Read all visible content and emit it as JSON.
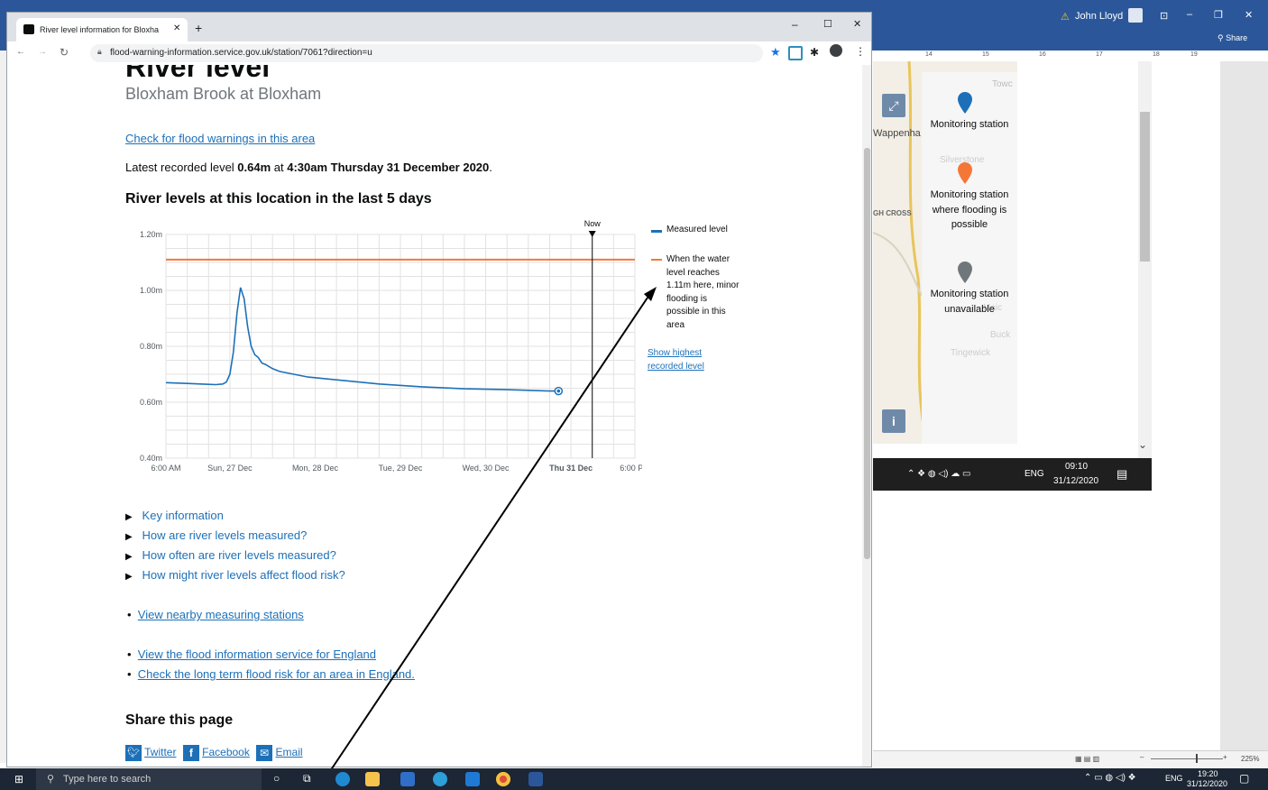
{
  "word": {
    "user_name": "John Lloyd",
    "share_label": "Share",
    "ruler_ticks": [
      "14",
      "15",
      "16",
      "17",
      "18",
      "19"
    ],
    "zoom_level": "225%"
  },
  "map_legend": {
    "items": [
      {
        "label": "Monitoring station",
        "color": "#1d70b8"
      },
      {
        "label": "Monitoring station where flooding is possible",
        "color": "#f47738"
      },
      {
        "label": "Monitoring station unavailable",
        "color": "#6f777b"
      }
    ],
    "place_labels": [
      "Wappenha",
      "Silverstone",
      "GH CROSS",
      "Tingewick",
      "Buck",
      "Maic",
      "Towc"
    ]
  },
  "mini_taskbar": {
    "lang": "ENG",
    "time": "09:10",
    "date": "31/12/2020"
  },
  "browser": {
    "tab_title": "River level information for Bloxha",
    "url": "flood-warning-information.service.gov.uk/station/7061?direction=u"
  },
  "page": {
    "heading": "River level",
    "subheading": "Bloxham Brook at Bloxham",
    "flood_warnings_link": "Check for flood warnings in this area",
    "latest_prefix": "Latest recorded level ",
    "latest_value": "0.64m",
    "latest_mid": " at ",
    "latest_time": "4:30am Thursday 31 December 2020",
    "latest_suffix": ".",
    "chart_heading": "River levels at this location in the last 5 days",
    "details": [
      "Key information",
      "How are river levels measured?",
      "How often are river levels measured?",
      "How might river levels affect flood risk?"
    ],
    "nearby_link": "View nearby measuring stations",
    "links": [
      "View the flood information service for England",
      "Check the long term flood risk for an area in England."
    ],
    "share_heading": "Share this page",
    "share_links": [
      "Twitter",
      "Facebook",
      "Email"
    ]
  },
  "chart_legend": {
    "measured": "Measured level",
    "threshold_lines": [
      "When the water",
      "level reaches",
      "1.11m here, minor",
      "flooding is",
      "possible in this",
      "area"
    ],
    "show_highest": [
      "Show highest",
      "recorded level"
    ],
    "now_label": "Now"
  },
  "chart_data": {
    "type": "line",
    "title": "River levels at this location in the last 5 days",
    "xlabel": "",
    "ylabel": "",
    "x_ticks": [
      "6:00 AM",
      "Sun, 27 Dec",
      "Mon, 28 Dec",
      "Tue, 29 Dec",
      "Wed, 30 Dec",
      "Thu 31 Dec",
      "6:00 PM"
    ],
    "y_ticks": [
      "0.40m",
      "0.60m",
      "0.80m",
      "1.00m",
      "1.20m"
    ],
    "ylim": [
      0.4,
      1.2
    ],
    "xlim_hours": [
      0,
      132
    ],
    "grid": true,
    "threshold": 1.11,
    "now_hour": 120,
    "series": [
      {
        "name": "Measured level",
        "x_hours": [
          0,
          6,
          12,
          14,
          16,
          17,
          18,
          19,
          20,
          21,
          22,
          23,
          24,
          25,
          26,
          27,
          28,
          30,
          32,
          36,
          40,
          48,
          60,
          72,
          84,
          96,
          108,
          110.5
        ],
        "values": [
          0.67,
          0.667,
          0.664,
          0.663,
          0.665,
          0.672,
          0.7,
          0.78,
          0.92,
          1.01,
          0.97,
          0.87,
          0.8,
          0.77,
          0.76,
          0.74,
          0.735,
          0.72,
          0.71,
          0.7,
          0.69,
          0.68,
          0.665,
          0.655,
          0.648,
          0.645,
          0.64,
          0.64
        ]
      }
    ]
  },
  "taskbar": {
    "search_placeholder": "Type here to search",
    "lang": "ENG",
    "time": "19:20",
    "date": "31/12/2020"
  }
}
